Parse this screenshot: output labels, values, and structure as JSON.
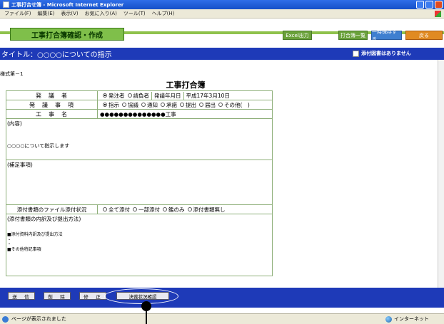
{
  "window": {
    "title": "工事打合せ簿 - Microsoft Internet Explorer"
  },
  "menu": [
    "ファイル(F)",
    "編集(E)",
    "表示(V)",
    "お気に入り(A)",
    "ツール(T)",
    "ヘルプ(H)"
  ],
  "header": {
    "page_title": "工事打合簿確認・作成",
    "buttons": {
      "excel": "Excel出力",
      "list": "打合簿一覧",
      "temp": "一時保存する",
      "back": "戻る"
    }
  },
  "subject": {
    "title": "タイトル：○○○○についての指示",
    "no_attachment_label": "添付図書はありません"
  },
  "form": {
    "form_number": "様式第－1",
    "heading": "工事打合簿",
    "issuer": {
      "label": "発　議　者",
      "options": [
        "発注者",
        "請負者"
      ],
      "selected": "発注者",
      "date_label": "発議年月日",
      "date_value": "平成17年3月10日"
    },
    "matter": {
      "label": "発　議　事　項",
      "options": [
        "指示",
        "協議",
        "通知",
        "承諾",
        "提出",
        "届出",
        "その他(　)"
      ],
      "selected": "指示"
    },
    "work_name": {
      "label": "工　事　名",
      "value": "●●●●●●●●●●●●●●工事"
    },
    "content": {
      "label": "(内容)",
      "text": "○○○○について指示します"
    },
    "supplement": {
      "label": "(補足事項)"
    },
    "attachment_status": {
      "label": "添付書類のファイル添付状況",
      "options": [
        "全て添付",
        "一部添付",
        "鑑のみ",
        "添付書類無し"
      ]
    },
    "attachment_detail": {
      "label": "(添付書類の内訳及び提出方法)",
      "line1": "■添付資料内訳及び提出方法",
      "dot1": "・",
      "dot2": "・",
      "line2": "■その他特記事項"
    }
  },
  "toolbar": {
    "send": "送　信",
    "delete": "削　除",
    "edit": "修　正",
    "decision": "決裁状況確認"
  },
  "status": {
    "text": "ページが表示されました",
    "zone": "インターネット"
  }
}
